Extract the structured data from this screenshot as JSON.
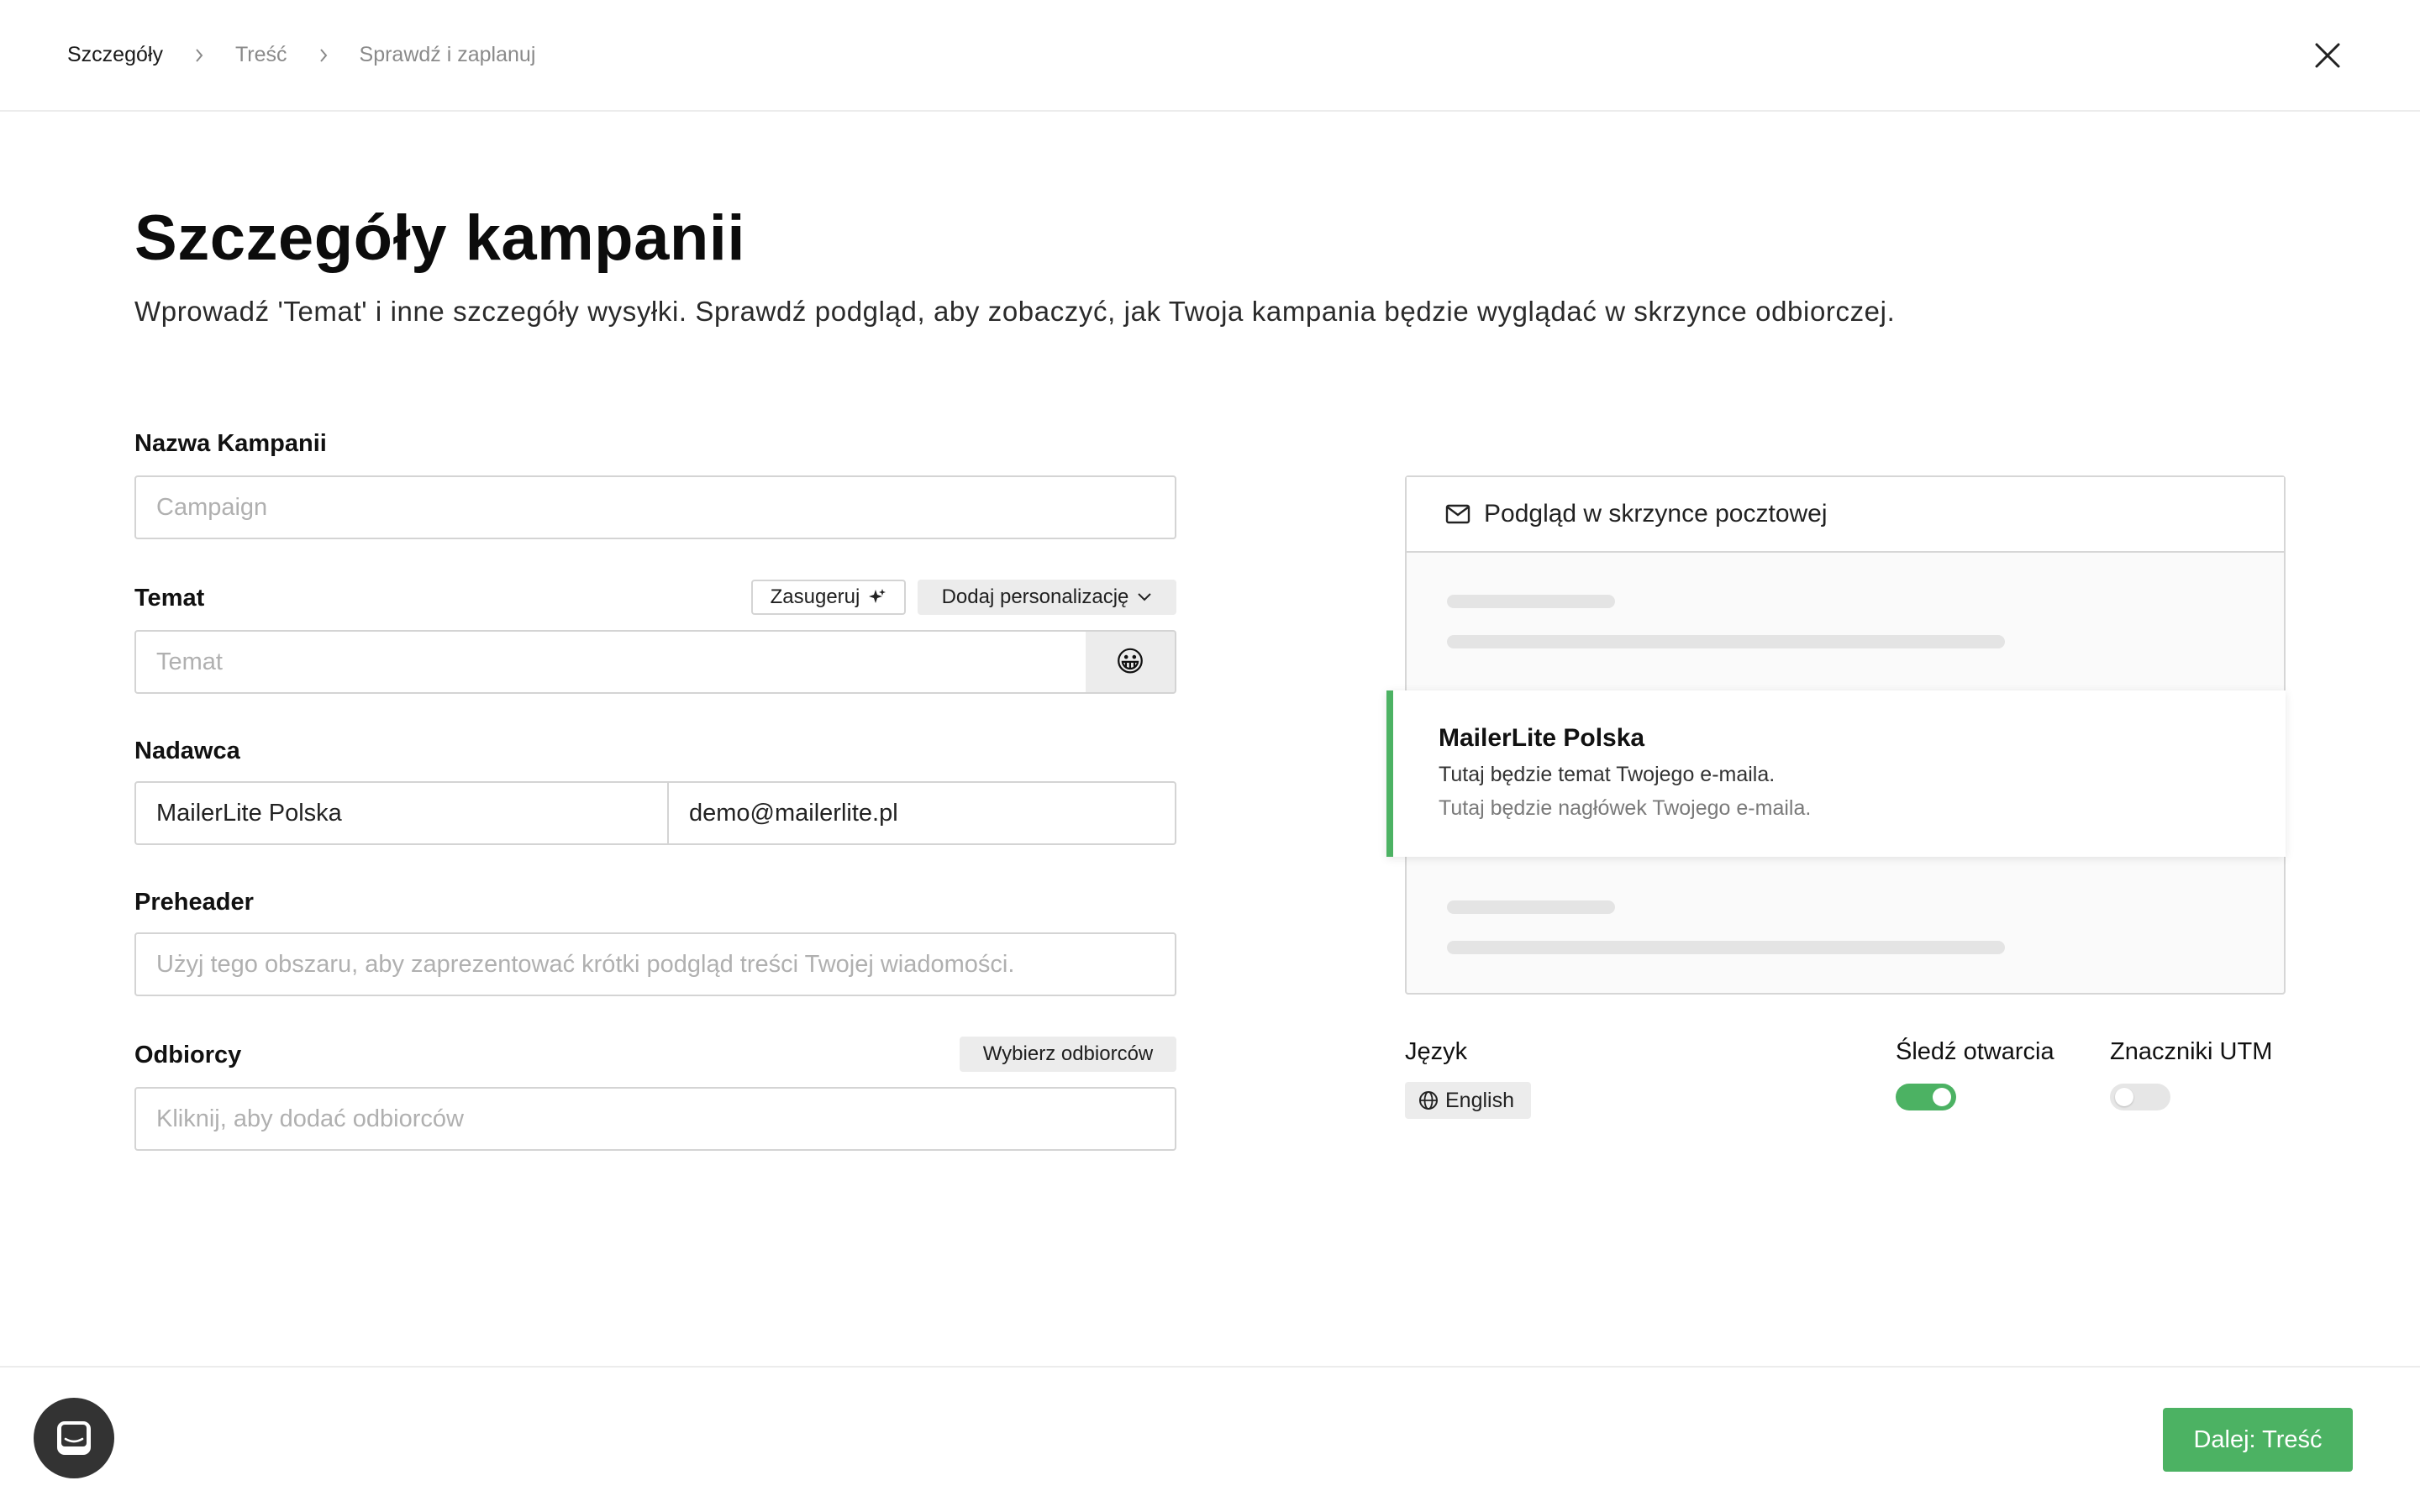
{
  "breadcrumb": {
    "items": [
      "Szczegóły",
      "Treść",
      "Sprawdź i zaplanuj"
    ]
  },
  "header": {
    "title": "Szczegóły kampanii",
    "subtitle": "Wprowadź 'Temat' i inne szczegóły wysyłki. Sprawdź podgląd, aby zobaczyć, jak Twoja kampania będzie wyglądać w skrzynce odbiorczej."
  },
  "form": {
    "campaign_name": {
      "label": "Nazwa Kampanii",
      "placeholder": "Campaign",
      "value": ""
    },
    "subject": {
      "label": "Temat",
      "placeholder": "Temat",
      "value": "",
      "suggest_label": "Zasugeruj",
      "personalize_label": "Dodaj personalizację",
      "emoji": "😀"
    },
    "sender": {
      "label": "Nadawca",
      "name": "MailerLite Polska",
      "email": "demo@mailerlite.pl"
    },
    "preheader": {
      "label": "Preheader",
      "placeholder": "Użyj tego obszaru, aby zaprezentować krótki podgląd treści Twojej wiadomości."
    },
    "recipients": {
      "label": "Odbiorcy",
      "select_label": "Wybierz odbiorców",
      "placeholder": "Kliknij, aby dodać odbiorców"
    }
  },
  "preview": {
    "title": "Podgląd w skrzynce pocztowej",
    "sender": "MailerLite Polska",
    "subject": "Tutaj będzie temat Twojego e-maila.",
    "header": "Tutaj będzie nagłówek Twojego e-maila."
  },
  "options": {
    "language": {
      "label": "Język",
      "value": "English"
    },
    "track_opens": {
      "label": "Śledź otwarcia",
      "enabled": true
    },
    "utm_tags": {
      "label": "Znaczniki UTM",
      "enabled": false
    }
  },
  "footer": {
    "next_label": "Dalej: Treść"
  },
  "colors": {
    "accent": "#4cb263",
    "chat": "#333333"
  },
  "icons": [
    "chevron-right-icon",
    "close-icon",
    "sparkle-icon",
    "chevron-down-icon",
    "envelope-icon",
    "globe-icon",
    "chat-icon"
  ]
}
